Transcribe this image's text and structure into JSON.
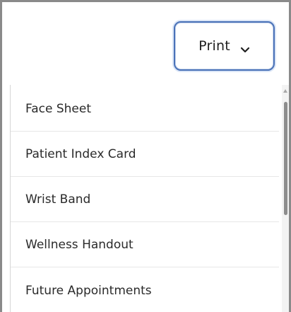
{
  "print_button": {
    "label": "Print",
    "icon": "chevron-down-icon"
  },
  "menu": {
    "items": [
      {
        "label": "Face Sheet"
      },
      {
        "label": "Patient Index Card"
      },
      {
        "label": "Wrist Band"
      },
      {
        "label": "Wellness Handout"
      },
      {
        "label": "Future Appointments"
      }
    ]
  },
  "colors": {
    "button_border": "#4a72b8",
    "text": "#2a2a2a",
    "divider": "#e7e7e7"
  }
}
